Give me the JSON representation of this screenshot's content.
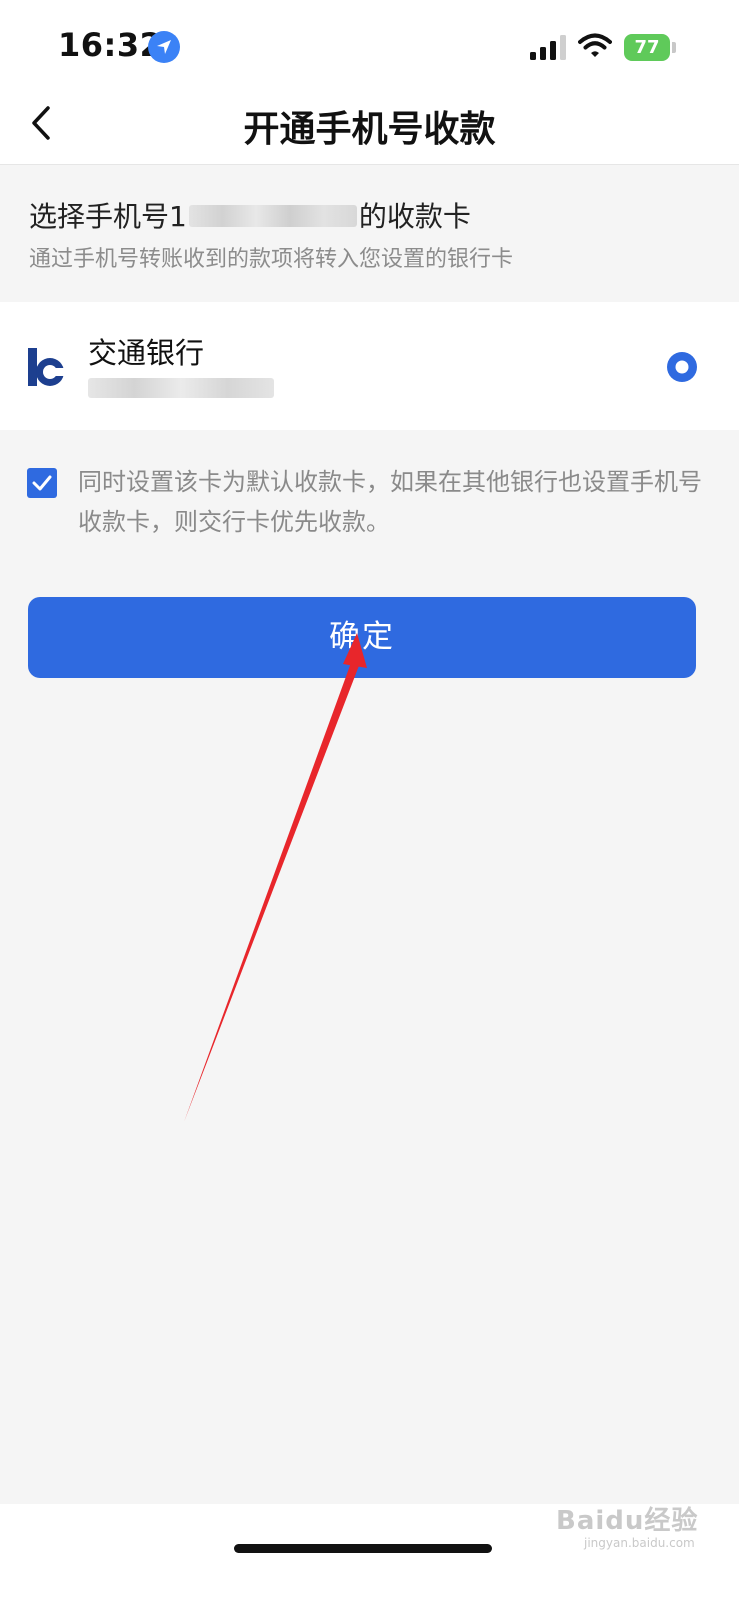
{
  "status_bar": {
    "time": "16:32",
    "battery": "77"
  },
  "nav": {
    "title": "开通手机号收款"
  },
  "intro": {
    "title_prefix": "选择手机号1",
    "title_suffix": "的收款卡",
    "subtitle": "通过手机号转账收到的款项将转入您设置的银行卡"
  },
  "card": {
    "bank_name": "交通银行",
    "selected": true
  },
  "agreement": {
    "checked": true,
    "text": "同时设置该卡为默认收款卡，如果在其他银行也设置手机号收款卡，则交行卡优先收款。"
  },
  "confirm": {
    "label": "确定"
  },
  "watermark": {
    "text": "Baidu经验",
    "sub": "jingyan.baidu.com"
  },
  "colors": {
    "accent": "#2f6ae0",
    "annotation": "#e8262b"
  }
}
